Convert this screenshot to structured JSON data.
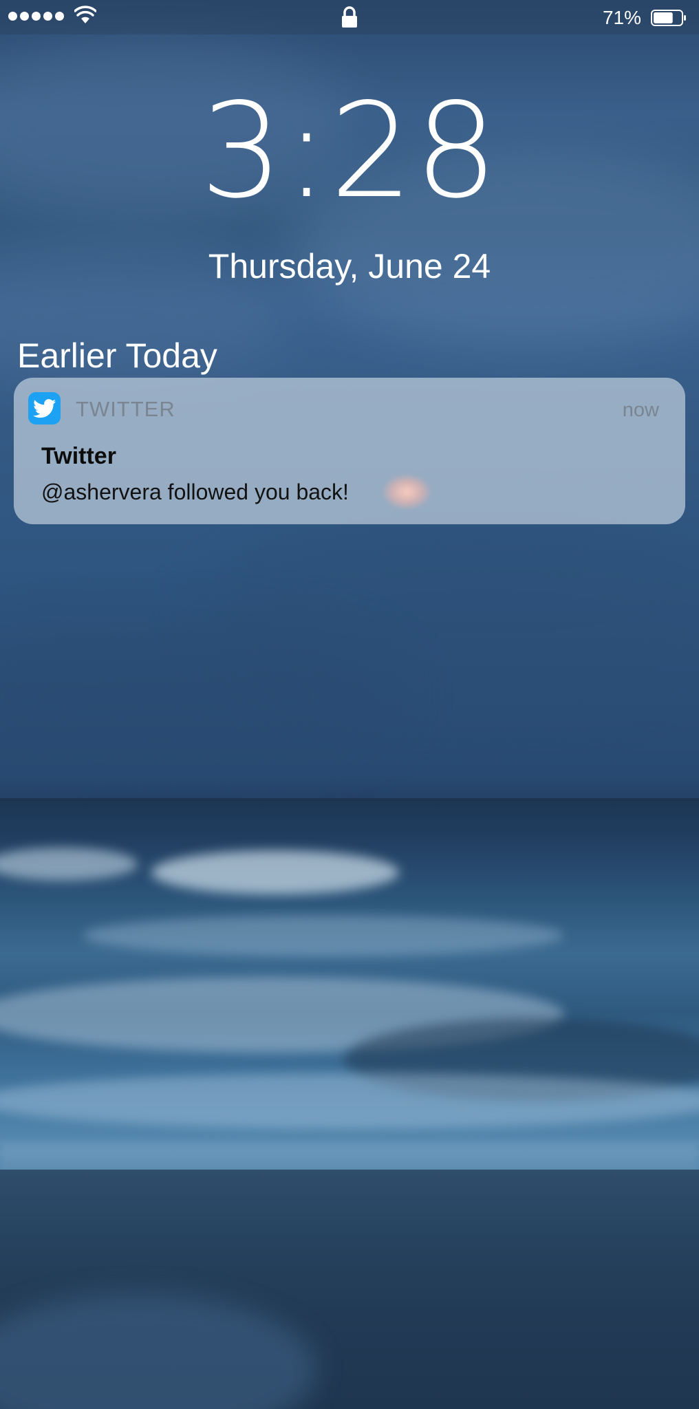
{
  "status_bar": {
    "battery_percent": "71%",
    "battery_level": 0.71,
    "signal_bars": 5
  },
  "lock_screen": {
    "time": "3:28",
    "date": "Thursday, June 24"
  },
  "notifications": {
    "section_title": "Earlier Today",
    "items": [
      {
        "app_name": "TWITTER",
        "app_icon": "twitter-bird-icon",
        "time": "now",
        "title": "Twitter",
        "body": "@ashervera followed you back!"
      }
    ]
  },
  "colors": {
    "twitter_blue": "#1da1f2"
  }
}
